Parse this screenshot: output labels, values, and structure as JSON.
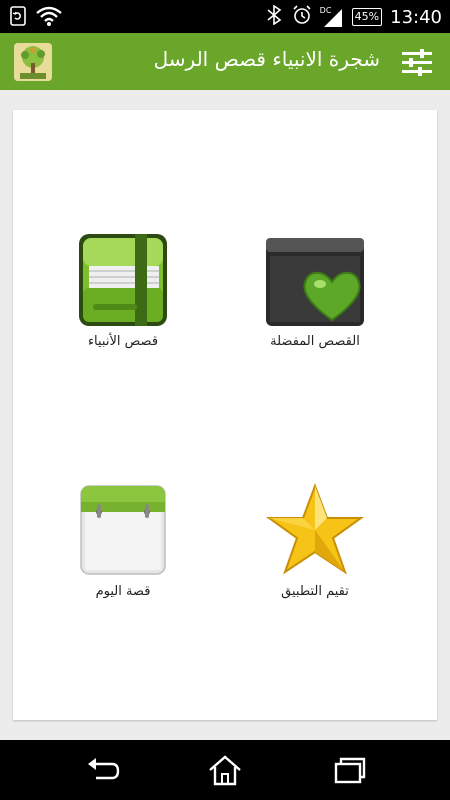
{
  "status_bar": {
    "time": "13:40",
    "battery": "45%",
    "network": "DC",
    "icons": [
      "sync-icon",
      "wifi-icon",
      "bluetooth-icon",
      "alarm-icon",
      "signal-icon",
      "battery-icon"
    ]
  },
  "app_bar": {
    "title": "شجرة الانبياء قصص الرسل",
    "logo_icon": "tree-logo-icon",
    "settings_icon": "sliders-icon"
  },
  "tiles": [
    {
      "label": "قصص الأنبياء",
      "icon": "green-book-icon"
    },
    {
      "label": "القصص المفضلة",
      "icon": "heart-box-icon"
    },
    {
      "label": "قصة اليوم",
      "icon": "calendar-icon"
    },
    {
      "label": "تقيم التطبيق",
      "icon": "star-icon"
    }
  ],
  "nav_bar": {
    "icons": [
      "back-icon",
      "home-icon",
      "recents-icon"
    ]
  },
  "colors": {
    "app_bar": "#6aa62a",
    "accent_green": "#8cc63f",
    "star_gold": "#f6c416"
  }
}
